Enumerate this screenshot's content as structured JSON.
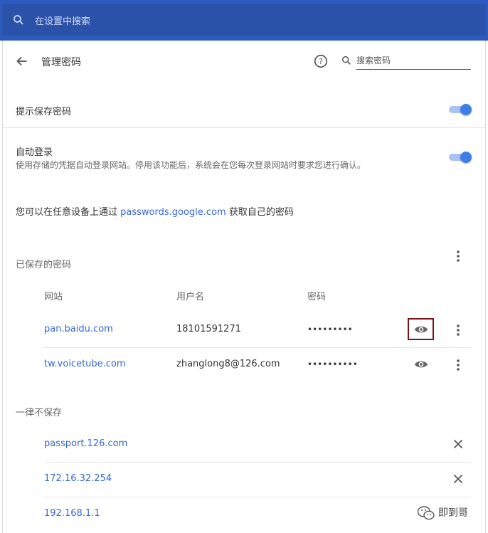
{
  "search_bar": {
    "placeholder": "在设置中搜索"
  },
  "header": {
    "title": "管理密码",
    "search_placeholder": "搜索密码"
  },
  "offer_to_save": {
    "label": "提示保存密码",
    "enabled": true
  },
  "auto_signin": {
    "label": "自动登录",
    "description": "使用存储的凭据自动登录网站。停用该功能后，系统会在您每次登录网站时要求您进行确认。",
    "enabled": true
  },
  "google_note": {
    "prefix": "您可以在任意设备上通过 ",
    "link": "passwords.google.com",
    "suffix": " 获取自己的密码"
  },
  "saved": {
    "title": "已保存的密码",
    "columns": {
      "site": "网站",
      "username": "用户名",
      "password": "密码"
    },
    "rows": [
      {
        "site": "pan.baidu.com",
        "username": "18101591271",
        "password": "•••••••••"
      },
      {
        "site": "tw.voicetube.com",
        "username": "zhanglong8@126.com",
        "password": "••••••••••"
      }
    ]
  },
  "never_saved": {
    "title": "一律不保存",
    "rows": [
      {
        "site": "passport.126.com"
      },
      {
        "site": "172.16.32.254"
      },
      {
        "site": "192.168.1.1"
      }
    ]
  },
  "watermark": {
    "text": "即到哥"
  },
  "colors": {
    "accent": "#3367d6",
    "topbar": "#2a52a8",
    "highlight": "#7a1212"
  }
}
